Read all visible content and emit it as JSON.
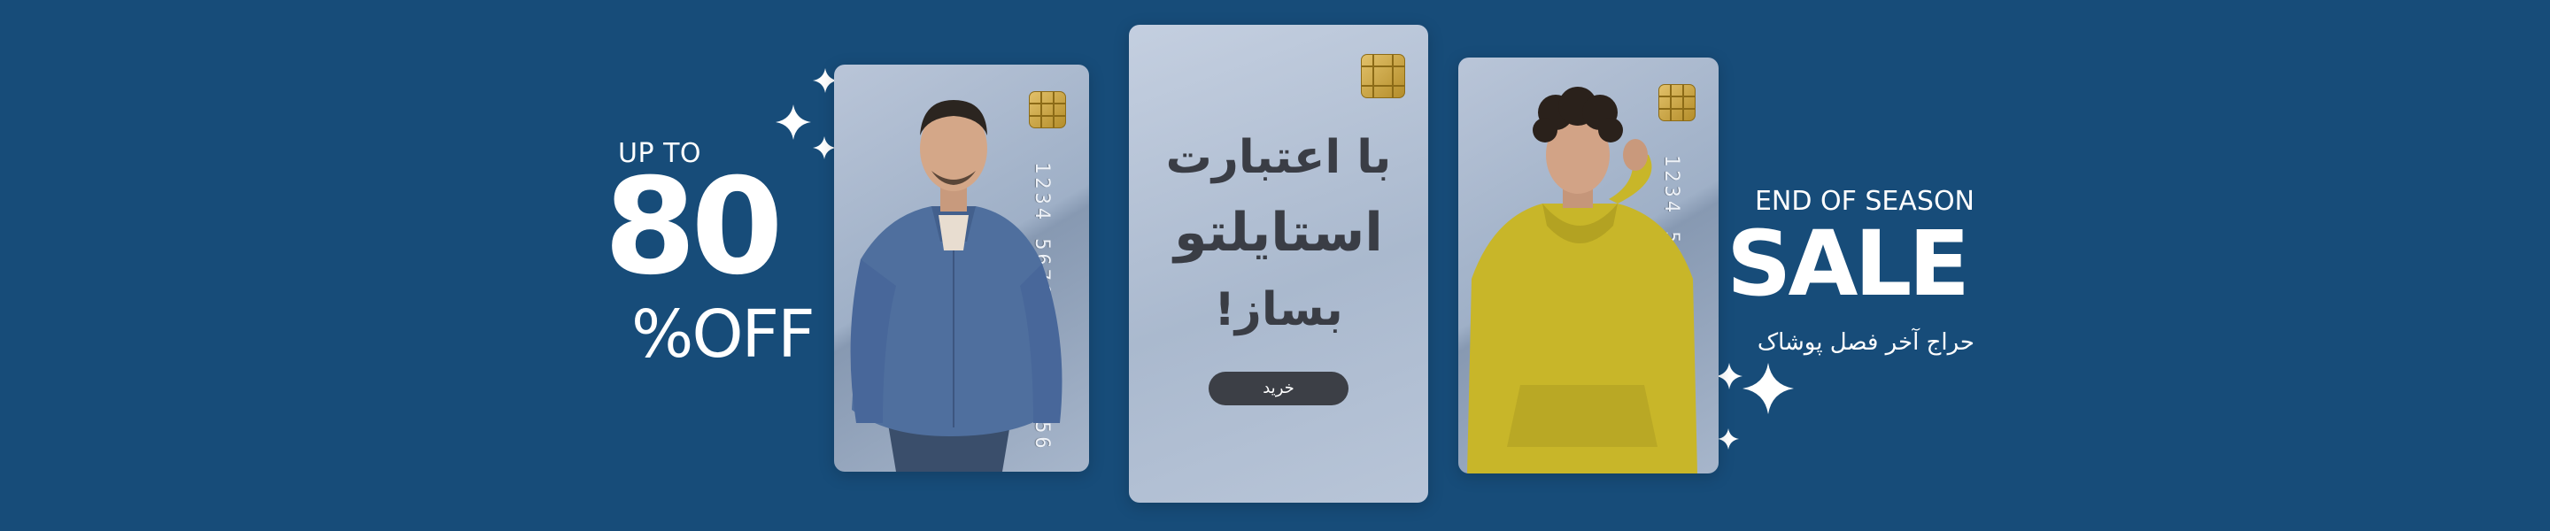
{
  "left_promo": {
    "up_to": "UP TO",
    "percent": "80",
    "off": "%OFF"
  },
  "right_promo": {
    "end_of_season": "END OF SEASON",
    "sale": "SALE",
    "subtitle": "حراج آخر فصل پوشاک"
  },
  "cards": {
    "left": {
      "number": "1234 5678 9012 3456"
    },
    "center": {
      "line1": "با اعتبارت",
      "line2": "استایلتو",
      "line3": "بساز!",
      "button": "خرید"
    },
    "right": {
      "number": "1234 5678 9012 3456"
    }
  },
  "colors": {
    "background": "#174c79",
    "sweater_blue": "#4f6f9e",
    "hoodie_yellow": "#c8b629",
    "button": "#3c3f46"
  }
}
